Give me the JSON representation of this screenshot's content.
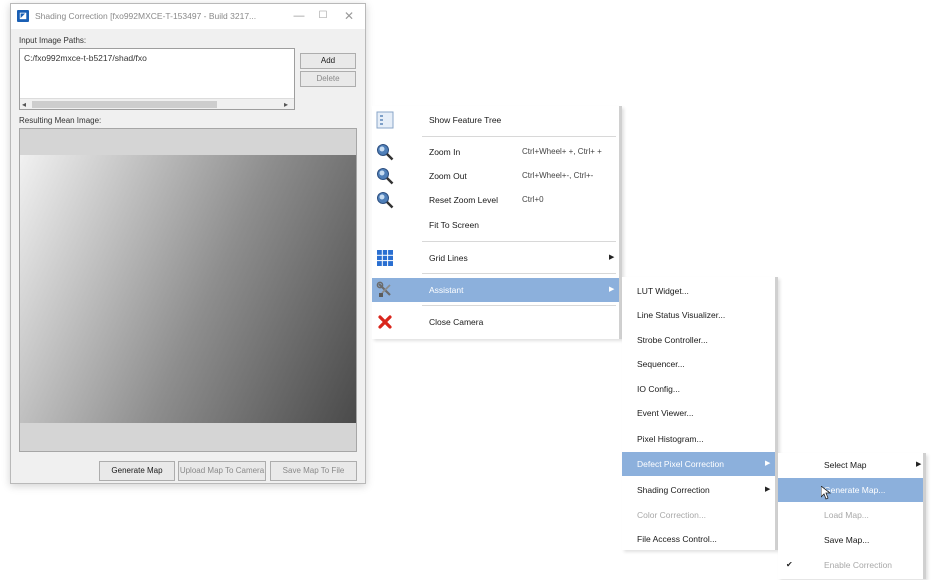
{
  "dialog": {
    "title": "Shading Correction [fxo992MXCE-T-153497 - Build 3217...",
    "input_label": "Input Image Paths:",
    "path_value": "C:/fxo992mxce-t-b5217/shad/fxo",
    "add_label": "Add",
    "delete_label": "Delete",
    "result_label": "Resulting Mean Image:",
    "generate_label": "Generate Map",
    "upload_label": "Upload Map To Camera",
    "save_label": "Save Map To File",
    "window_buttons": {
      "minimize": "—",
      "maximize": "☐",
      "close": "✕"
    },
    "scroll": {
      "left": "◂",
      "right": "▸"
    }
  },
  "context_menu": {
    "items": [
      {
        "label": "Show Feature Tree",
        "icon": "feature-tree-icon"
      },
      {
        "label": "Zoom In",
        "shortcut": "Ctrl+Wheel+ +, Ctrl+ +",
        "icon": "zoom-in-icon"
      },
      {
        "label": "Zoom Out",
        "shortcut": "Ctrl+Wheel+-, Ctrl+-",
        "icon": "zoom-out-icon"
      },
      {
        "label": "Reset Zoom Level",
        "shortcut": "Ctrl+0",
        "icon": "zoom-reset-icon"
      },
      {
        "label": "Fit To Screen"
      },
      {
        "label": "Grid Lines",
        "icon": "grid-icon",
        "arrow": "▶"
      },
      {
        "label": "Assistant",
        "icon": "tools-icon",
        "arrow": "▶"
      },
      {
        "label": "Close Camera",
        "icon": "close-camera-icon"
      }
    ]
  },
  "assistant_menu": {
    "items": [
      {
        "label": "LUT Widget..."
      },
      {
        "label": "Line Status Visualizer..."
      },
      {
        "label": "Strobe Controller..."
      },
      {
        "label": "Sequencer..."
      },
      {
        "label": "IO Config..."
      },
      {
        "label": "Event Viewer..."
      },
      {
        "label": "Pixel Histogram..."
      },
      {
        "label": "Defect Pixel Correction",
        "arrow": "▶"
      },
      {
        "label": "Shading Correction",
        "arrow": "▶"
      },
      {
        "label": "Color Correction..."
      },
      {
        "label": "File Access Control..."
      }
    ]
  },
  "dpc_menu": {
    "items": [
      {
        "label": "Select Map",
        "arrow": "▶"
      },
      {
        "label": "Generate Map..."
      },
      {
        "label": "Load Map..."
      },
      {
        "label": "Save Map..."
      },
      {
        "label": "Enable Correction",
        "check": "✔"
      }
    ]
  },
  "colors": {
    "highlight": "#8cb0dc",
    "accent": "#1a5fb4",
    "close_red": "#d9261c"
  }
}
